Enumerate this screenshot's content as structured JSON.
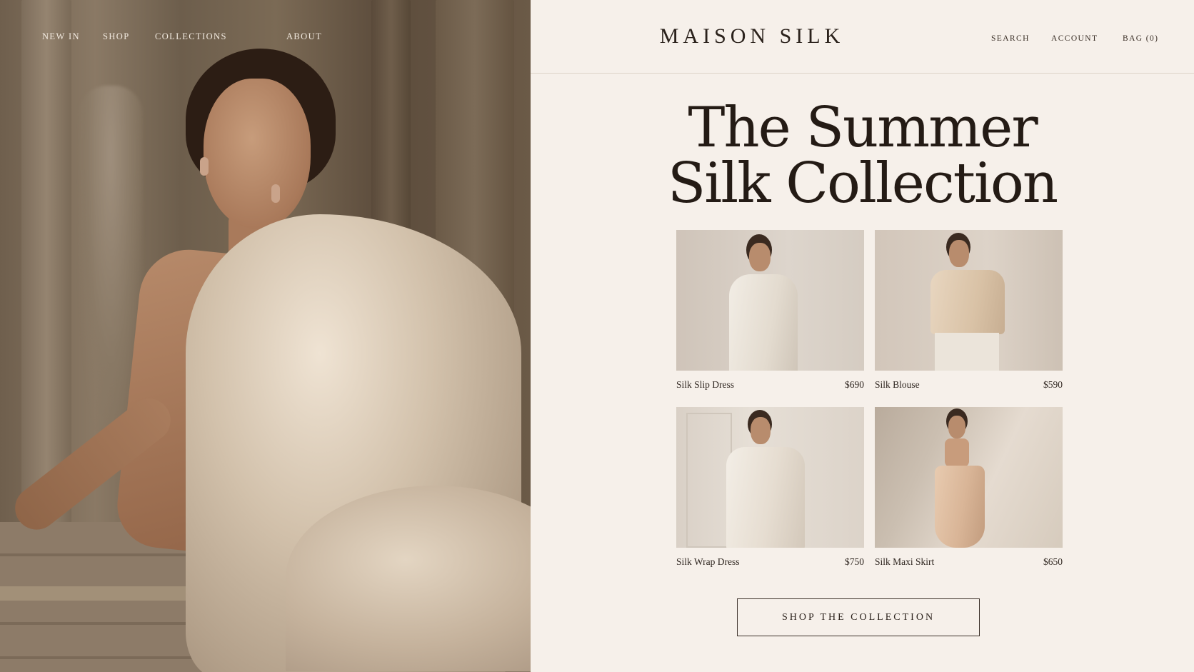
{
  "nav": {
    "items": [
      {
        "label": "NEW IN"
      },
      {
        "label": "SHOP"
      },
      {
        "label": "COLLECTIONS"
      },
      {
        "label": "ABOUT"
      }
    ]
  },
  "brand": {
    "name": "MAISON SILK"
  },
  "utility": {
    "search": "SEARCH",
    "account": "ACCOUNT",
    "bag": "BAG (0)"
  },
  "hero": {
    "line1": "The Summer",
    "line2": "Silk Collection"
  },
  "products": [
    {
      "name": "Silk Slip Dress",
      "price": "$690"
    },
    {
      "name": "Silk Blouse",
      "price": "$590"
    },
    {
      "name": "Silk Wrap Dress",
      "price": "$750"
    },
    {
      "name": "Silk Maxi Skirt",
      "price": "$650"
    }
  ],
  "cta": {
    "label": "SHOP THE COLLECTION"
  },
  "colors": {
    "background": "#f6f0ea",
    "text": "#2a211b",
    "silk": "#d9c9b4"
  }
}
